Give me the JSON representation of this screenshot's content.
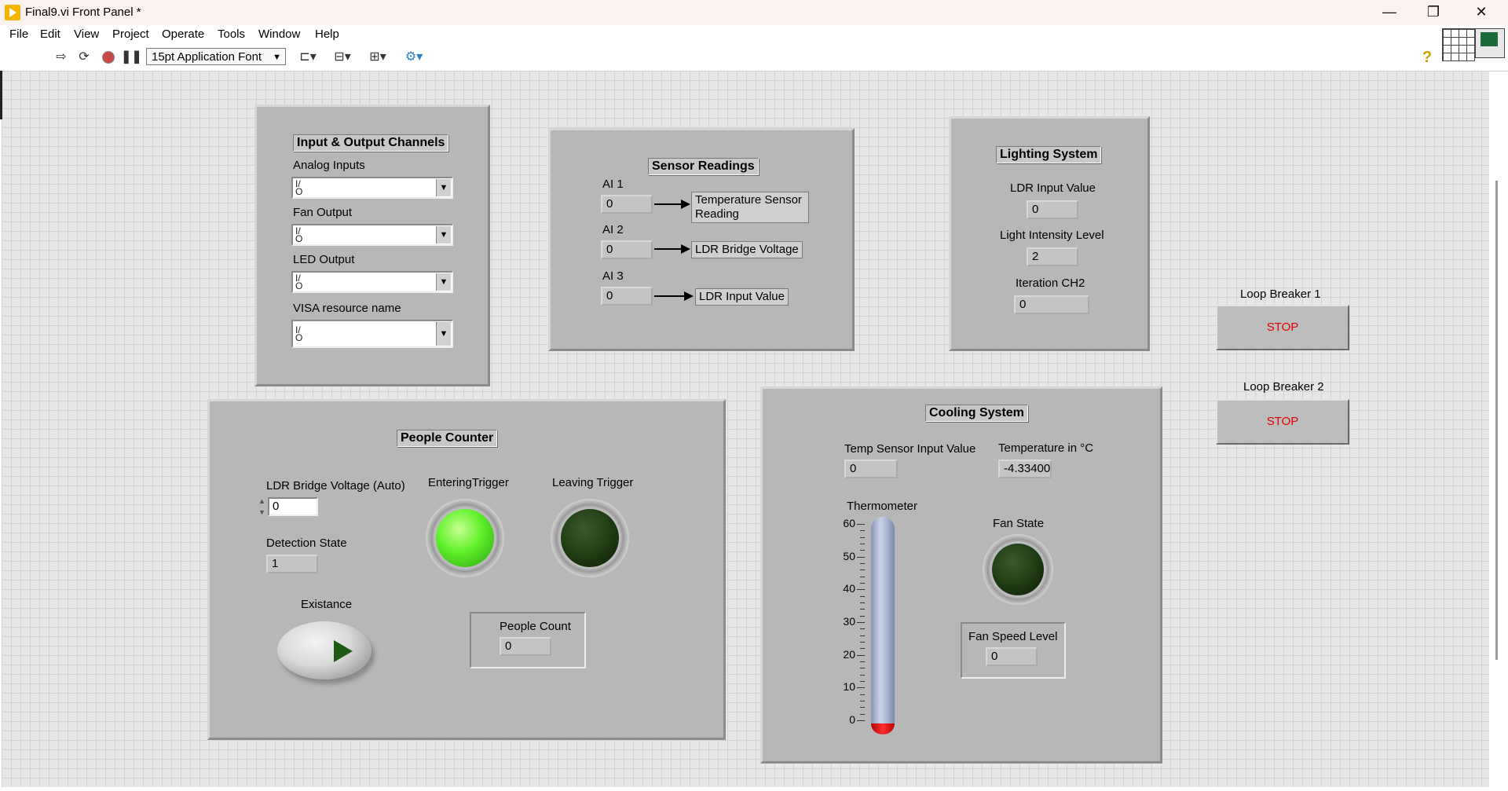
{
  "window": {
    "title": "Final9.vi Front Panel *",
    "buttons": [
      "—",
      "❐",
      "✕"
    ]
  },
  "menu": [
    "File",
    "Edit",
    "View",
    "Project",
    "Operate",
    "Tools",
    "Window",
    "Help"
  ],
  "toolbar": {
    "font": "15pt Application Font",
    "icons": [
      "run-arrow-icon",
      "run-continuous-icon",
      "abort-icon",
      "pause-icon",
      "align-icon",
      "distribute-icon",
      "resize-icon",
      "reorder-icon",
      "help-icon"
    ]
  },
  "io_panel": {
    "title": "Input & Output Channels",
    "fields": [
      {
        "label": "Analog Inputs",
        "value": ""
      },
      {
        "label": "Fan Output",
        "value": ""
      },
      {
        "label": "LED Output",
        "value": ""
      },
      {
        "label": "VISA resource name",
        "value": ""
      }
    ],
    "io_glyph": "I/O"
  },
  "sensor_panel": {
    "title": "Sensor Readings",
    "channels": [
      {
        "label": "AI 1",
        "value": "0",
        "target": "Temperature Sensor Reading"
      },
      {
        "label": "AI 2",
        "value": "0",
        "target": "LDR Bridge Voltage"
      },
      {
        "label": "AI 3",
        "value": "0",
        "target": "LDR Input Value"
      }
    ]
  },
  "lighting_panel": {
    "title": "Lighting System",
    "ldr_label": "LDR Input Value",
    "ldr_value": "0",
    "intensity_label": "Light Intensity Level",
    "intensity_value": "2",
    "iteration_label": "Iteration CH2",
    "iteration_value": "0"
  },
  "loop_breakers": [
    {
      "label": "Loop Breaker 1",
      "button": "STOP"
    },
    {
      "label": "Loop Breaker 2",
      "button": "STOP"
    }
  ],
  "people_panel": {
    "title": "People Counter",
    "ldr_label": "LDR Bridge Voltage (Auto)",
    "ldr_value": "0",
    "detection_label": "Detection State",
    "detection_value": "1",
    "entering_label": "EnteringTrigger",
    "entering_on": true,
    "leaving_label": "Leaving Trigger",
    "leaving_on": false,
    "existance_label": "Existance",
    "count_label": "People Count",
    "count_value": "0"
  },
  "cooling_panel": {
    "title": "Cooling System",
    "temp_input_label": "Temp Sensor Input Value",
    "temp_input_value": "0",
    "temp_c_label": "Temperature in °C",
    "temp_c_value": "-4.33400",
    "thermo_label": "Thermometer",
    "thermo_scale": [
      60,
      50,
      40,
      30,
      20,
      10,
      0
    ],
    "thermo_level": 0,
    "fan_state_label": "Fan State",
    "fan_on": false,
    "fan_speed_label": "Fan Speed Level",
    "fan_speed_value": "0"
  },
  "colors": {
    "led_on": "#5ef02a",
    "led_off": "#1e3a12",
    "stop_text": "#e00000",
    "panel_bg": "#b7b7b7"
  }
}
